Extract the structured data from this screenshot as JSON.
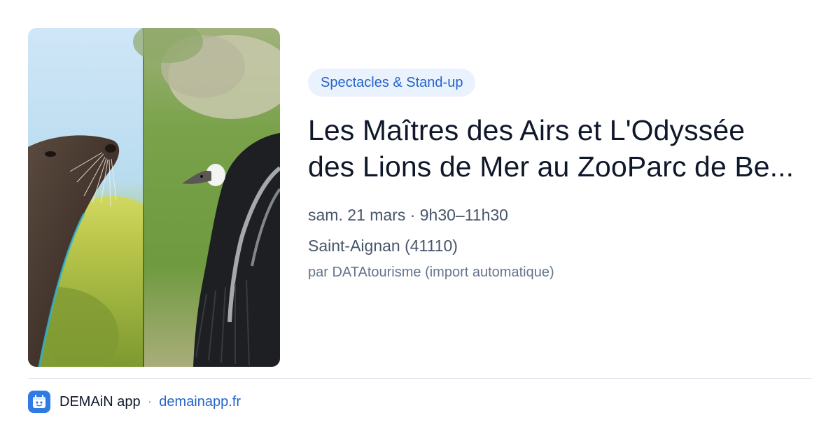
{
  "event": {
    "category": "Spectacles & Stand-up",
    "title": "Les Maîtres des Airs et L'Odyssée des Lions de Mer au ZooParc de Be...",
    "date_time": "sam. 21 mars · 9h30–11h30",
    "location": "Saint-Aignan (41110)",
    "source": "par DATAtourisme (import automatique)"
  },
  "footer": {
    "app_name": "DEMAiN app",
    "separator": "·",
    "domain": "demainapp.fr"
  },
  "colors": {
    "accent": "#2563c9",
    "badge_bg": "#eaf2fd",
    "logo_bg": "#2f7be6",
    "title": "#0f172a",
    "meta": "#475569"
  },
  "icons": {
    "logo": "demain-app-logo-icon"
  }
}
